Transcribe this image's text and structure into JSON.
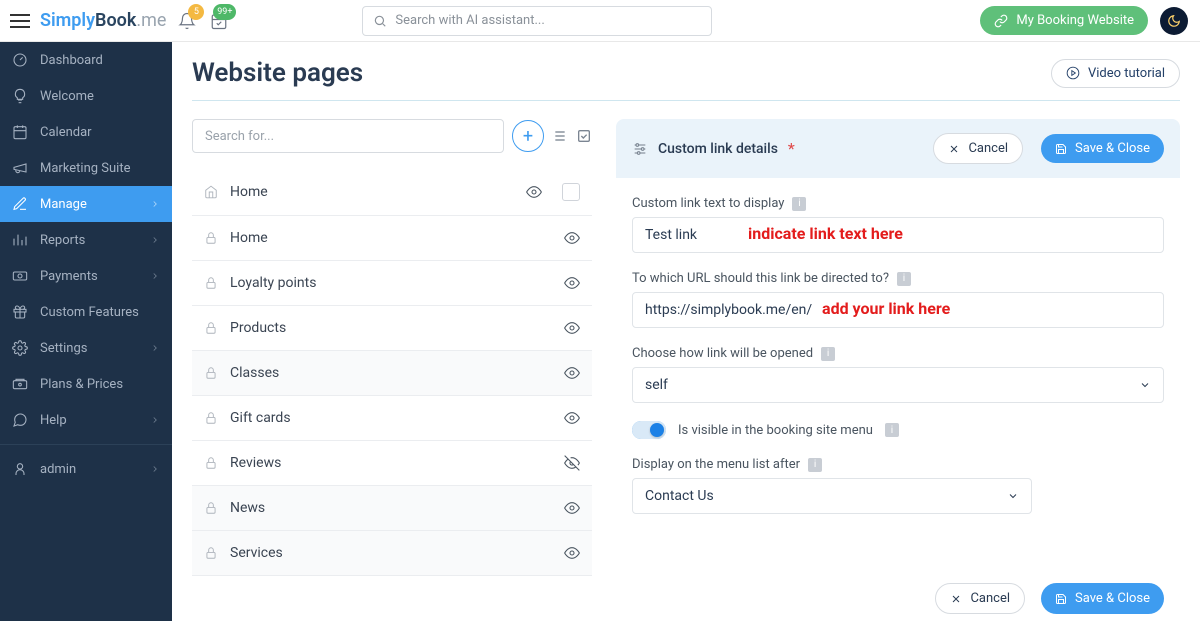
{
  "header": {
    "brand_s": "Simply",
    "brand_b": "Book",
    "brand_me": ".me",
    "notif_badge": "5",
    "cal_badge": "99+",
    "search_placeholder": "Search with AI assistant...",
    "booking_btn": "My Booking Website"
  },
  "sidebar": {
    "items": [
      {
        "label": "Dashboard"
      },
      {
        "label": "Welcome"
      },
      {
        "label": "Calendar"
      },
      {
        "label": "Marketing Suite"
      },
      {
        "label": "Manage",
        "active": true,
        "chev": true
      },
      {
        "label": "Reports",
        "chev": true
      },
      {
        "label": "Payments",
        "chev": true
      },
      {
        "label": "Custom Features"
      },
      {
        "label": "Settings",
        "chev": true
      },
      {
        "label": "Plans & Prices"
      },
      {
        "label": "Help",
        "chev": true
      }
    ],
    "admin": "admin"
  },
  "page": {
    "title": "Website pages",
    "video_tutorial": "Video tutorial",
    "search_placeholder": "Search for...",
    "pages": [
      {
        "label": "Home",
        "iconType": "home",
        "checkbox": true
      },
      {
        "label": "Home",
        "iconType": "lock"
      },
      {
        "label": "Loyalty points",
        "iconType": "lock"
      },
      {
        "label": "Products",
        "iconType": "lock"
      },
      {
        "label": "Classes",
        "iconType": "lock",
        "alt": true
      },
      {
        "label": "Gift cards",
        "iconType": "lock"
      },
      {
        "label": "Reviews",
        "iconType": "lock",
        "hidden": true
      },
      {
        "label": "News",
        "iconType": "lock",
        "alt": true
      },
      {
        "label": "Services",
        "iconType": "lock",
        "alt": true
      }
    ]
  },
  "panel": {
    "title": "Custom link details",
    "cancel": "Cancel",
    "save": "Save & Close",
    "field1_label": "Custom link text to display",
    "field1_value": "Test link",
    "field1_anno": "indicate link text here",
    "field2_label": "To which URL should this link be directed to?",
    "field2_value": "https://simplybook.me/en/",
    "field2_anno": "add your link here",
    "field3_label": "Choose how link will be opened",
    "field3_value": "self",
    "toggle_label": "Is visible in the booking site menu",
    "field4_label": "Display on the menu list after",
    "field4_value": "Contact Us"
  }
}
